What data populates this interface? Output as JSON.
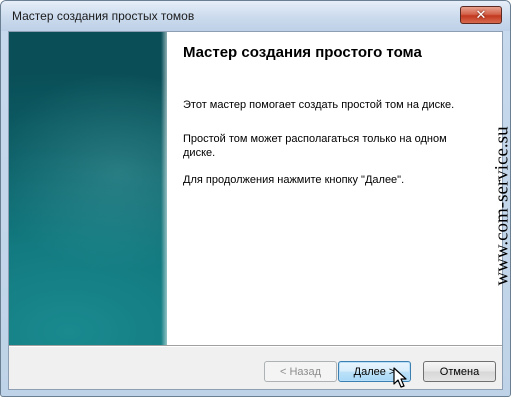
{
  "window": {
    "title": "Мастер создания простых томов",
    "close_glyph": "✕"
  },
  "wizard": {
    "heading": "Мастер создания простого тома",
    "paragraphs": [
      "Этот мастер помогает создать простой том на диске.",
      "Простой том может располагаться только на одном диске.",
      "Для продолжения нажмите кнопку \"Далее\"."
    ]
  },
  "buttons": {
    "back": "< Назад",
    "next": "Далее >",
    "cancel": "Отмена"
  },
  "watermark": "www.com-service.su",
  "colors": {
    "sidebar": "#0c5e66",
    "accent_button": "#3c7fb1",
    "close_button": "#c2391f"
  },
  "icons": {
    "close": "close-icon",
    "cursor": "mouse-pointer-icon"
  }
}
